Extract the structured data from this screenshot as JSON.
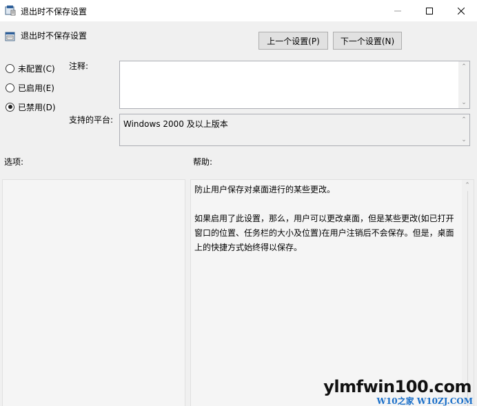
{
  "window": {
    "title": "退出时不保存设置",
    "minimize_icon": "minimize-icon",
    "maximize_icon": "maximize-icon",
    "close_icon": "close-icon"
  },
  "header": {
    "setting_name": "退出时不保存设置",
    "prev_button": "上一个设置(P)",
    "next_button": "下一个设置(N)"
  },
  "state_options": [
    {
      "label": "未配置(C)",
      "checked": false
    },
    {
      "label": "已启用(E)",
      "checked": false
    },
    {
      "label": "已禁用(D)",
      "checked": true
    }
  ],
  "comment": {
    "label": "注释:",
    "value": ""
  },
  "supported_platform": {
    "label": "支持的平台:",
    "value": "Windows 2000 及以上版本"
  },
  "options_label": "选项:",
  "help": {
    "label": "帮助:",
    "text": "防止用户保存对桌面进行的某些更改。\n\n如果启用了此设置，那么，用户可以更改桌面，但是某些更改(如已打开窗口的位置、任务栏的大小及位置)在用户注销后不会保存。但是，桌面上的快捷方式始终得以保存。"
  },
  "watermark": {
    "main": "ylmfwin100.com",
    "sub": "W10之家 W10ZJ.COM"
  }
}
